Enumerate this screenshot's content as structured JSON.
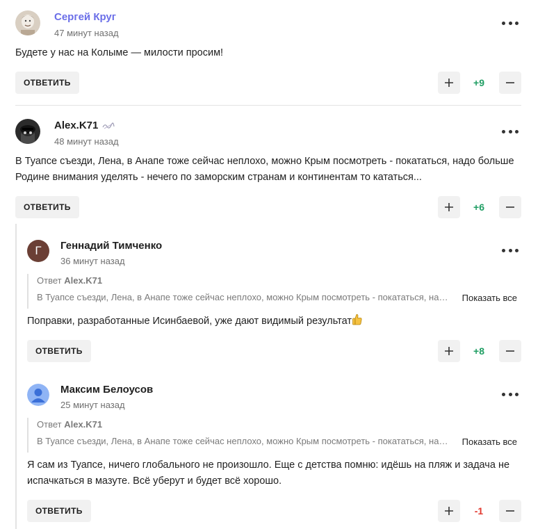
{
  "ui": {
    "reply_label": "ОТВЕТИТЬ",
    "reply_prefix": "Ответ",
    "show_all_label": "Показать все"
  },
  "comments": [
    {
      "author": "Сергей Круг",
      "time": "47 минут назад",
      "text": "Будете у нас на Колыме — милости просим!",
      "score": "+9"
    },
    {
      "author": "Alex.K71",
      "time": "48 минут назад",
      "text_line1": "В Туапсе съезди, Лена, в Анапе тоже сейчас неплохо, можно Крым посмотреть - покататься, надо больше",
      "text_line2": "Родине внимания уделять - нечего по заморским странам и континентам то кататься...",
      "score": "+6"
    },
    {
      "author": "Геннадий Тимченко",
      "avatar_letter": "Г",
      "time": "36 минут назад",
      "reply_to": "Alex.K71",
      "quote": "В Туапсе съезди, Лена, в Анапе тоже сейчас неплохо, можно Крым посмотреть - покататься, надо больше Родине внимания уделять",
      "text": "Поправки, разработанные Исинбаевой, уже дают видимый результат",
      "score": "+8"
    },
    {
      "author": "Максим Белоусов",
      "time": "25 минут назад",
      "reply_to": "Alex.K71",
      "quote": "В Туапсе съезди, Лена, в Анапе тоже сейчас неплохо, можно Крым посмотреть - покататься, надо больше Родине внимания уделять",
      "text_line1": "Я сам из Туапсе, ничего глобального не произошло. Еще с детства помню: идёшь на пляж и задача не",
      "text_line2": "испачкаться в мазуте. Всё уберут и будет всё хорошо.",
      "score": "-1"
    }
  ],
  "colors": {
    "accent_name": "#6a6ee8",
    "score_positive": "#1f9e63",
    "score_negative": "#e2382e",
    "button_bg": "#f1f1f1"
  },
  "icons": {
    "plus": "plus-icon",
    "minus": "minus-icon",
    "more": "more-dots-icon",
    "thumb": "thumbs-up-emoji"
  }
}
